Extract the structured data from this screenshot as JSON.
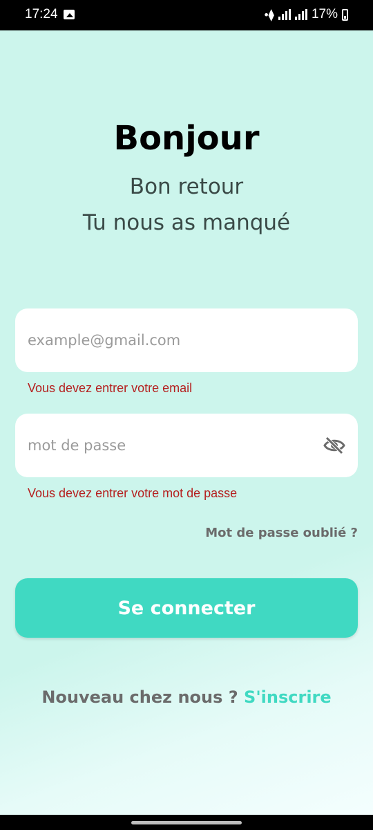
{
  "status_bar": {
    "time": "17:24",
    "battery": "17%",
    "icons": [
      "gallery-icon",
      "wifi-icon",
      "signal-icon",
      "signal-icon",
      "battery-icon"
    ]
  },
  "header": {
    "title": "Bonjour",
    "subtitle_line1": "Bon retour",
    "subtitle_line2": "Tu nous as manqué"
  },
  "form": {
    "email_placeholder": "example@gmail.com",
    "email_error": "Vous devez entrer votre email",
    "password_placeholder": "mot de passe",
    "password_error": "Vous devez entrer votre mot de passe",
    "forgot_password": "Mot de passe oublié ?",
    "submit_label": "Se connecter"
  },
  "footer": {
    "question": "Nouveau chez nous ?",
    "signup_link": "S'inscrire"
  },
  "colors": {
    "accent": "#40d9c2",
    "background": "#ccf5ec",
    "error": "#b5201f"
  }
}
